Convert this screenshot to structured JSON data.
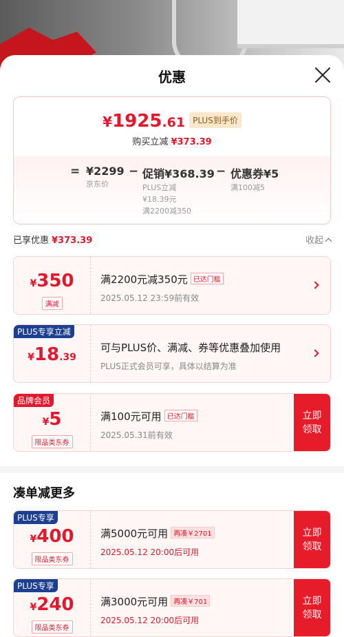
{
  "sheet": {
    "title": "优惠"
  },
  "price_card": {
    "yen": "¥",
    "integer": "1925",
    "decimal": ".61",
    "plus_tag": "PLUS到手价",
    "buy_save_label": "购买立减",
    "buy_save_amount": "¥373.39",
    "formula": {
      "equals": "=",
      "jd_price_value": "¥2299",
      "jd_price_label": "京东价",
      "minus1": "−",
      "promo_value": "促销¥368.39",
      "promo_lines": [
        "PLUS立减",
        "¥18.39元",
        "满2200减350"
      ],
      "minus2": "−",
      "coupon_value": "优惠券¥5",
      "coupon_label": "满100减5"
    }
  },
  "enjoyed": {
    "label": "已享优惠",
    "amount": "¥373.39",
    "collapse_label": "收起"
  },
  "coupons": [
    {
      "yen": "¥",
      "amount": "350",
      "decimal": "",
      "sub": "满减",
      "corner": "",
      "title": "满2200元减350元",
      "badge": "已达门槛",
      "desc": "2025.05.12 23:59前有效",
      "action": "arrow"
    },
    {
      "yen": "¥",
      "amount": "18",
      "decimal": ".39",
      "sub": "",
      "corner": "PLUS专享立减",
      "title": "可与PLUS价、满减、券等优惠叠加使用",
      "badge": "",
      "desc": "PLUS正式会员可享，具体以结算为准",
      "action": "arrow"
    },
    {
      "yen": "¥",
      "amount": "5",
      "decimal": "",
      "sub": "限品类东券",
      "corner": "品牌会员",
      "title": "满100元可用",
      "badge": "已达门槛",
      "desc": "2025.05.31前有效",
      "action": "立即\n领取"
    }
  ],
  "more": {
    "title": "凑单减更多",
    "coupons": [
      {
        "yen": "¥",
        "amount": "400",
        "sub": "限品类东券",
        "corner": "PLUS专享",
        "title": "满5000元可用",
        "badge": "再凑￥2701",
        "desc": "2025.05.12 20:00后可用",
        "action": "立即\n领取"
      },
      {
        "yen": "¥",
        "amount": "240",
        "sub": "限品类东券",
        "corner": "PLUS专享",
        "title": "满3000元可用",
        "badge": "再凑￥701",
        "desc": "2025.05.12 20:00后可用",
        "action": "立即\n领取"
      }
    ]
  },
  "colors": {
    "accent": "#e4182c",
    "plus_blue": "#1d3f91",
    "claim_red": "#e71c2b"
  }
}
